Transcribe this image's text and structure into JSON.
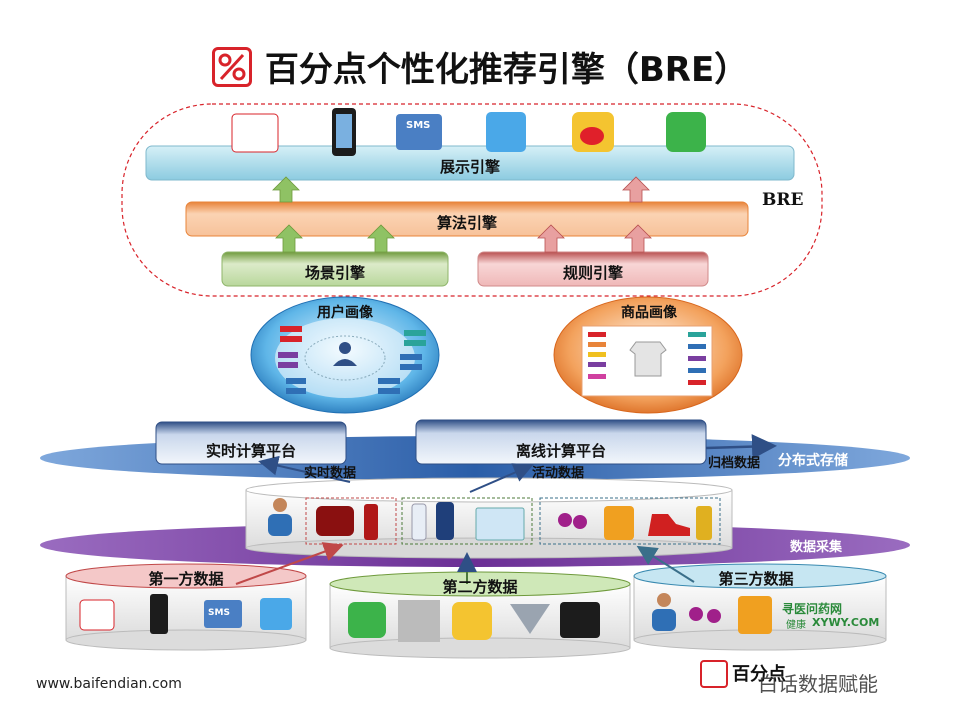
{
  "header": {
    "title": "百分点个性化推荐引擎（BRE）"
  },
  "bre": {
    "label": "BRE",
    "display_engine": "展示引擎",
    "algorithm_engine": "算法引擎",
    "scene_engine": "场景引擎",
    "rule_engine": "规则引擎"
  },
  "portraits": {
    "user": "用户画像",
    "product": "商品画像"
  },
  "compute": {
    "realtime_platform": "实时计算平台",
    "offline_platform": "离线计算平台",
    "realtime_data": "实时数据",
    "activity_data": "活动数据",
    "archive_data": "归档数据",
    "distributed_storage": "分布式存储",
    "data_collection": "数据采集"
  },
  "sources": {
    "first": "第一方数据",
    "second": "第二方数据",
    "third": "第三方数据"
  },
  "icons": {
    "sms": "SMS",
    "xywy_cn": "寻医问药网",
    "xywy_en": "XYWY.COM",
    "xywy_small": "健康"
  },
  "footer": {
    "url": "www.baifendian.com",
    "logo_text": "百分点",
    "watermark": "白话数据赋能"
  },
  "colors": {
    "accent_red": "#d8232a",
    "display_bar": "#a8dbe8",
    "algo_bar": "#f4b183",
    "scene_bar": "#a9d18e",
    "rule_bar": "#f4b0b0",
    "disk": "#7a3ea0",
    "disk_blue": "#2f6fb5"
  }
}
